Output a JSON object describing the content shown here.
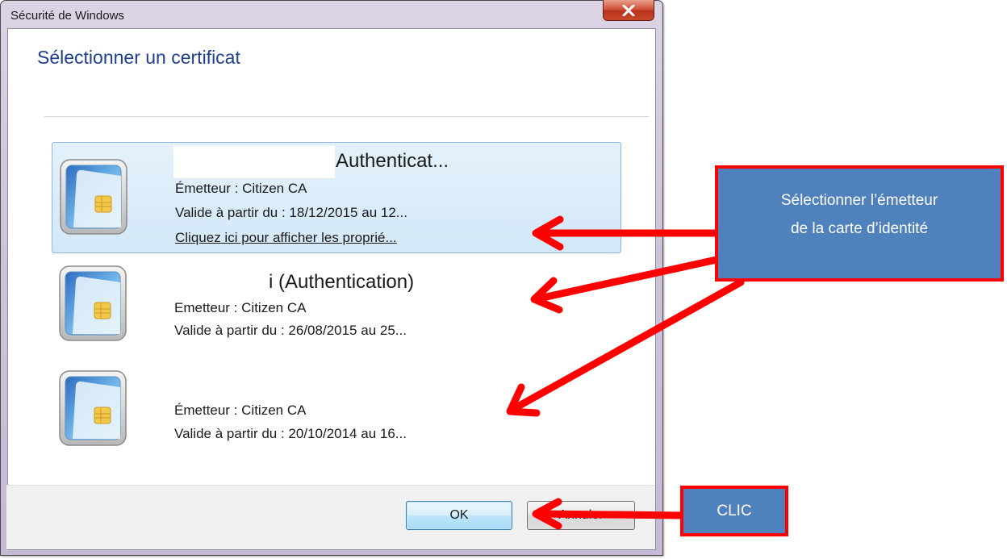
{
  "window": {
    "title": "Sécurité de Windows",
    "close_glyph": "✕"
  },
  "dialog": {
    "heading": "Sélectionner un certificat",
    "certificates": [
      {
        "name": "Authenticat...",
        "issuer": "Émetteur : Citizen CA",
        "validity": "Valide à partir du : 18/12/2015 au 12...",
        "link": "Cliquez ici pour afficher les proprié...",
        "selected": true
      },
      {
        "name": "i (Authentication)",
        "issuer": "Emetteur : Citizen CA",
        "validity": "Valide à partir du : 26/08/2015 au 25...",
        "selected": false
      },
      {
        "name": "",
        "issuer": "Émetteur : Citizen CA",
        "validity": "Valide à partir du : 20/10/2014 au 16...",
        "selected": false
      }
    ],
    "buttons": {
      "ok": "OK",
      "cancel": "Annuler"
    }
  },
  "annotations": {
    "select_issuer": "Sélectionner l’émetteur de la carte d’identité",
    "select_issuer_line1": "Sélectionner l’émetteur",
    "select_issuer_line2": "de la carte d’identité",
    "click": "CLIC",
    "callout_fill": "#4f81bd",
    "callout_border": "#ff0000",
    "arrow_color": "#ff0000"
  },
  "icons": [
    "close-icon",
    "smart-card-icon"
  ]
}
